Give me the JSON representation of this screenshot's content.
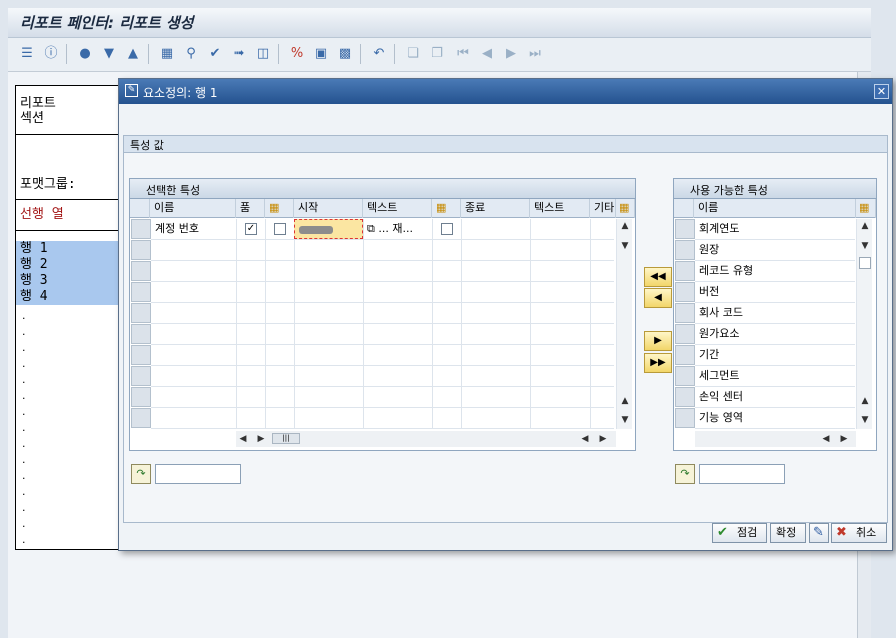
{
  "window": {
    "title": "리포트 페인터: 리포트 생성"
  },
  "toolbar": {
    "icons": [
      "hierarchy-icon",
      "info-icon",
      "lock-icon",
      "filter-icon",
      "org-icon",
      "add-row-icon",
      "zoom-icon",
      "check-icon",
      "cursor-icon",
      "trash-icon",
      "percent-icon",
      "frame-icon",
      "doc-icon",
      "undo-icon",
      "copy-icon",
      "paste-icon",
      "first-icon",
      "prev-icon",
      "next-icon",
      "last-icon"
    ]
  },
  "left_panel": {
    "report_label": "리포트",
    "section_label": "섹션",
    "format_group_label": "포맷그룹:",
    "lead_column_label": "선행 열",
    "rows": [
      "행 1",
      "행 2",
      "행 3",
      "행 4"
    ]
  },
  "dialog": {
    "title": "요소정의: 행 1",
    "group_title": "특성 값",
    "selected": {
      "title": "선택한 특성",
      "columns": [
        "이름",
        "품",
        "",
        "시작",
        "텍스트",
        "",
        "종료",
        "텍스트",
        "기타"
      ],
      "rows": [
        {
          "name": "계정 번호",
          "checked": true,
          "from_text": "... 재..."
        }
      ]
    },
    "available": {
      "title": "사용 가능한 특성",
      "column": "이름",
      "items": [
        "회계연도",
        "원장",
        "레코드 유형",
        "버전",
        "회사 코드",
        "원가요소",
        "기간",
        "세그먼트",
        "손익 센터",
        "기능 영역"
      ]
    },
    "buttons": {
      "check": "점검",
      "confirm": "확정",
      "cancel": "취소"
    }
  }
}
